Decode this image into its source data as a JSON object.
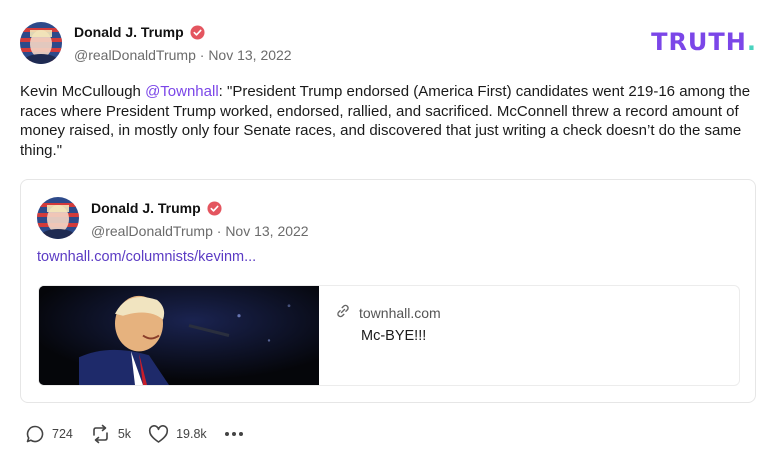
{
  "post": {
    "author_name": "Donald J. Trump",
    "handle": "@realDonaldTrump",
    "separator": " · ",
    "date": "Nov 13, 2022",
    "text_before": "Kevin McCullough ",
    "mention": "@Townhall",
    "text_after": ": \"President Trump endorsed (America First) candidates went 219-16 among the races where President Trump worked, endorsed, rallied, and sacrificed. McConnell threw a record amount of money raised, in mostly only four Senate races, and discovered that just writing a check doesn’t do the same thing.\""
  },
  "logo": {
    "text": "TRUTH",
    "dot": ".",
    "color": "#7b46e8",
    "dot_color": "#4ad3bf"
  },
  "quote": {
    "author_name": "Donald J. Trump",
    "handle": "@realDonaldTrump",
    "separator": " · ",
    "date": "Nov 13, 2022",
    "link_text": "townhall.com/columnists/kevinm...",
    "card": {
      "domain": "townhall.com",
      "title": "Mc-BYE!!!",
      "link_icon": "link-icon"
    }
  },
  "actions": {
    "replies": "724",
    "retruths": "5k",
    "likes": "19.8k",
    "reply_icon": "reply-icon",
    "retruth_icon": "retruth-icon",
    "like_icon": "heart-icon",
    "more_icon": "more-icon"
  },
  "colors": {
    "accent": "#7b46e8",
    "verified": "#e4555f",
    "muted": "#6b6b6b"
  }
}
